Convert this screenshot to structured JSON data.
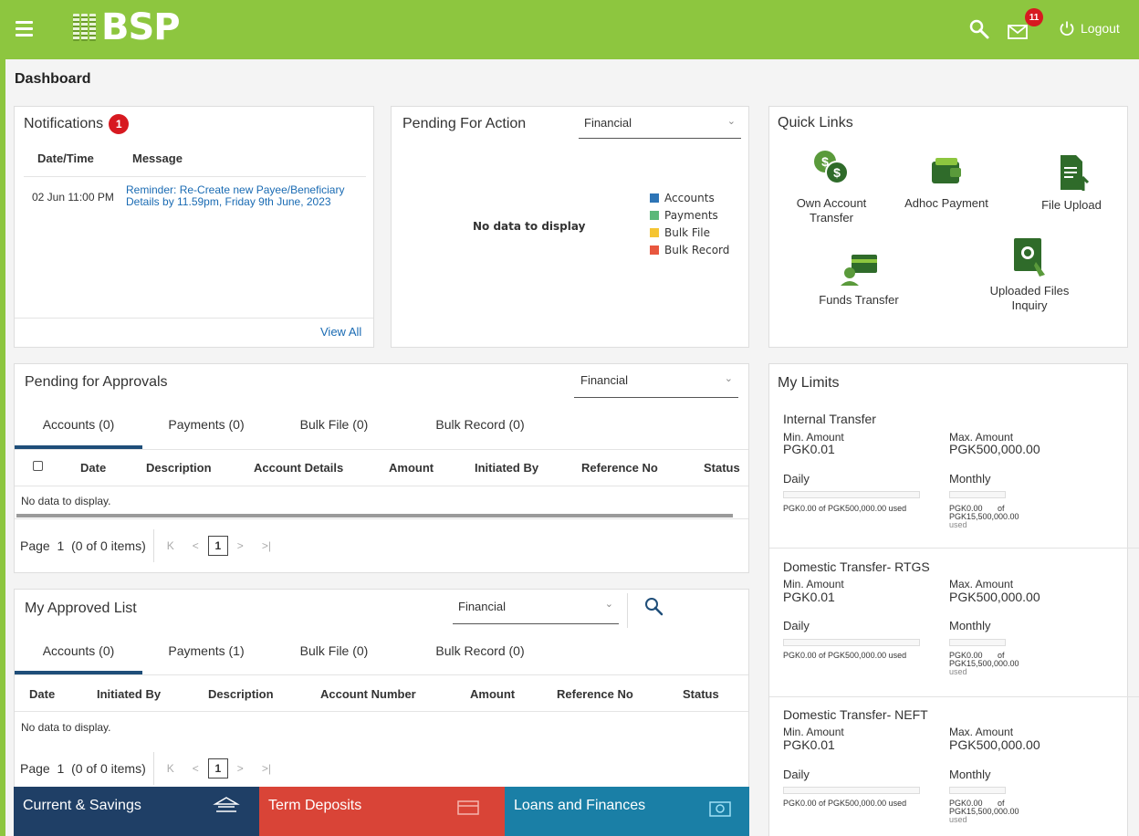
{
  "header": {
    "brand": "BSP",
    "mail_count": "11",
    "logout_label": "Logout"
  },
  "page_title": "Dashboard",
  "notifications": {
    "title": "Notifications",
    "count": "1",
    "col_datetime": "Date/Time",
    "col_message": "Message",
    "rows": [
      {
        "datetime": "02 Jun 11:00 PM",
        "message": "Reminder: Re-Create new Payee/Beneficiary Details by 11.59pm, Friday 9th June, 2023"
      }
    ],
    "view_all": "View All"
  },
  "pending_action": {
    "title": "Pending For Action",
    "filter": "Financial",
    "empty_text": "No data to display",
    "legend": [
      {
        "label": "Accounts",
        "color": "#2e75b6"
      },
      {
        "label": "Payments",
        "color": "#5cb87a"
      },
      {
        "label": "Bulk File",
        "color": "#f5c533"
      },
      {
        "label": "Bulk Record",
        "color": "#e8573f"
      }
    ]
  },
  "quick_links": {
    "title": "Quick Links",
    "items": [
      {
        "label": "Own Account Transfer",
        "icon": "coins-transfer-icon"
      },
      {
        "label": "Adhoc Payment",
        "icon": "wallet-icon"
      },
      {
        "label": "File Upload",
        "icon": "file-upload-icon"
      },
      {
        "label": "Funds Transfer",
        "icon": "funds-transfer-icon"
      },
      {
        "label": "Uploaded Files Inquiry",
        "icon": "file-inquiry-icon"
      }
    ]
  },
  "pending_approvals": {
    "title": "Pending for Approvals",
    "filter": "Financial",
    "tabs": [
      "Accounts (0)",
      "Payments (0)",
      "Bulk File (0)",
      "Bulk Record (0)"
    ],
    "columns": [
      "Date",
      "Description",
      "Account Details",
      "Amount",
      "Initiated By",
      "Reference No",
      "Status"
    ],
    "empty_text": "No data to display.",
    "page_label": "Page",
    "page_value": "1",
    "page_info": "(0 of 0 items)",
    "page_num": "1"
  },
  "approved_list": {
    "title": "My Approved List",
    "filter": "Financial",
    "tabs": [
      "Accounts (0)",
      "Payments (1)",
      "Bulk File (0)",
      "Bulk Record (0)"
    ],
    "columns": [
      "Date",
      "Initiated By",
      "Description",
      "Account Number",
      "Amount",
      "Reference No",
      "Status"
    ],
    "empty_text": "No data to display.",
    "page_label": "Page",
    "page_value": "1",
    "page_info": "(0 of 0 items)",
    "page_num": "1"
  },
  "limits": {
    "title": "My Limits",
    "items": [
      {
        "name": "Internal Transfer",
        "min_label": "Min. Amount",
        "min": "PGK0.01",
        "max_label": "Max. Amount",
        "max": "PGK500,000.00",
        "daily": "Daily",
        "monthly": "Monthly",
        "daily_used": "PGK0.00 of PGK500,000.00 used",
        "monthly_used_a": "PGK0.00",
        "monthly_used_of": "of",
        "monthly_used_b": "PGK15,500,000.00",
        "monthly_used_c": "used",
        "daily_fraction": 0,
        "monthly_fraction": 0
      },
      {
        "name": "Domestic Transfer- RTGS",
        "min_label": "Min. Amount",
        "min": "PGK0.01",
        "max_label": "Max. Amount",
        "max": "PGK500,000.00",
        "daily": "Daily",
        "monthly": "Monthly",
        "daily_used": "PGK0.00 of PGK500,000.00 used",
        "monthly_used_a": "PGK0.00",
        "monthly_used_of": "of",
        "monthly_used_b": "PGK15,500,000.00",
        "monthly_used_c": "used",
        "daily_fraction": 0,
        "monthly_fraction": 0
      },
      {
        "name": "Domestic Transfer- NEFT",
        "min_label": "Min. Amount",
        "min": "PGK0.01",
        "max_label": "Max. Amount",
        "max": "PGK500,000.00",
        "daily": "Daily",
        "monthly": "Monthly",
        "daily_used": "PGK0.00 of PGK500,000.00 used",
        "monthly_used_a": "PGK0.00",
        "monthly_used_of": "of",
        "monthly_used_b": "PGK15,500,000.00",
        "monthly_used_c": "used",
        "daily_fraction": 0,
        "monthly_fraction": 0
      }
    ]
  },
  "bottom_tiles": [
    {
      "label": "Current & Savings",
      "color": "#1f3f66"
    },
    {
      "label": "Term Deposits",
      "color": "#d94437"
    },
    {
      "label": "Loans and Finances",
      "color": "#1a7fa6"
    }
  ],
  "colors": {
    "brand_green": "#8dc63f",
    "badge_red": "#d71920",
    "link_blue": "#1a6bb3",
    "tab_active": "#1f4e79"
  }
}
